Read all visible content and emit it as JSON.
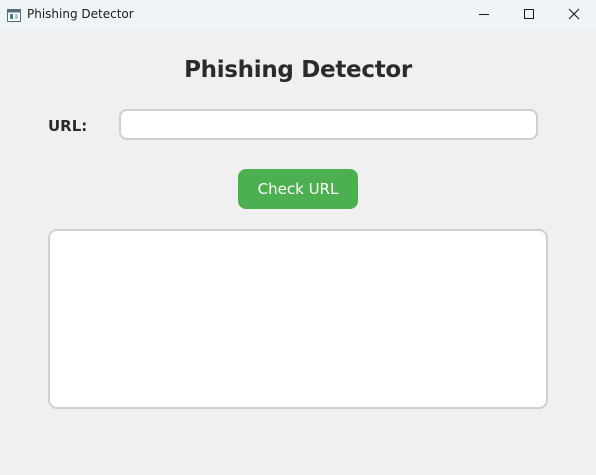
{
  "window": {
    "title": "Phishing Detector",
    "icon": "app-window-icon",
    "controls": {
      "minimize_icon": "minimize-icon",
      "maximize_icon": "maximize-icon",
      "close_icon": "close-icon"
    }
  },
  "main": {
    "heading": "Phishing Detector",
    "url_label": "URL:",
    "url_value": "",
    "url_placeholder": "",
    "check_button_label": "Check URL",
    "result_text": ""
  },
  "colors": {
    "background": "#f0f0f0",
    "titlebar": "#eff4f9",
    "accent_button": "#4caf50",
    "field_border": "#cfcfcf",
    "heading_text": "#2b2b2b"
  }
}
